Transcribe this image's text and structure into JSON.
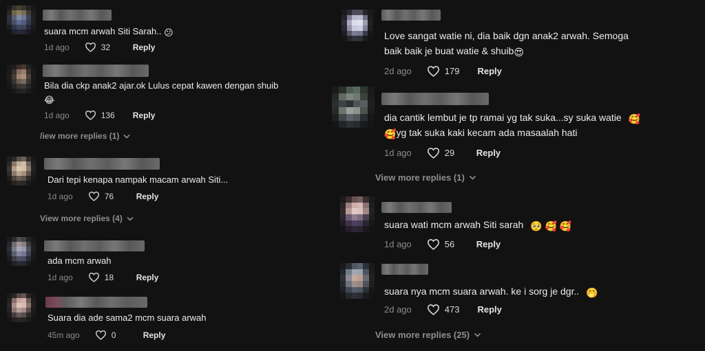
{
  "left": {
    "comments": [
      {
        "text": "suara mcm arwah Siti Sarah..",
        "emoji": "😕",
        "age": "1d ago",
        "likes": "32",
        "reply": "Reply"
      },
      {
        "text": "Bila dia ckp anak2 ajar.ok Lulus cepat kawen dengan shuib",
        "text2_emoji": "😂",
        "age": "1d ago",
        "likes": "136",
        "reply": "Reply",
        "more": "/iew more replies (1)"
      },
      {
        "text": "Dari tepi kenapa nampak macam arwah Siti...",
        "age": "1d ago",
        "likes": "76",
        "reply": "Reply",
        "more": "View more replies (4)"
      },
      {
        "text": "ada mcm arwah",
        "age": "1d ago",
        "likes": "18",
        "reply": "Reply"
      },
      {
        "text": "Suara dia ade sama2 mcm suara arwah",
        "age": "45m ago",
        "likes": "0",
        "reply": "Reply"
      }
    ]
  },
  "right": {
    "comments": [
      {
        "line1": "Love sangat watie ni, dia baik dgn anak2 arwah. Semoga",
        "line2": "baik baik je buat watie & shuib",
        "emoji": "😍",
        "age": "2d ago",
        "likes": "179",
        "reply": "Reply"
      },
      {
        "line1": "dia cantik lembut je tp ramai yg tak suka...sy suka watie",
        "line1_emoji": "🥰",
        "line2_emoji": "🥰",
        "line2": "yg tak suka kaki kecam ada masaalah hati",
        "age": "1d ago",
        "likes": "29",
        "reply": "Reply",
        "more": "View more replies (1)"
      },
      {
        "line1": "suara wati mcm arwah Siti sarah",
        "emojis": "🥺 🥰 🥰",
        "age": "1d ago",
        "likes": "56",
        "reply": "Reply"
      },
      {
        "line1": "suara nya mcm suara arwah. ke i sorg je dgr..",
        "emoji": "🤭",
        "age": "2d ago",
        "likes": "473",
        "reply": "Reply",
        "more": "View more replies (25)"
      }
    ]
  }
}
